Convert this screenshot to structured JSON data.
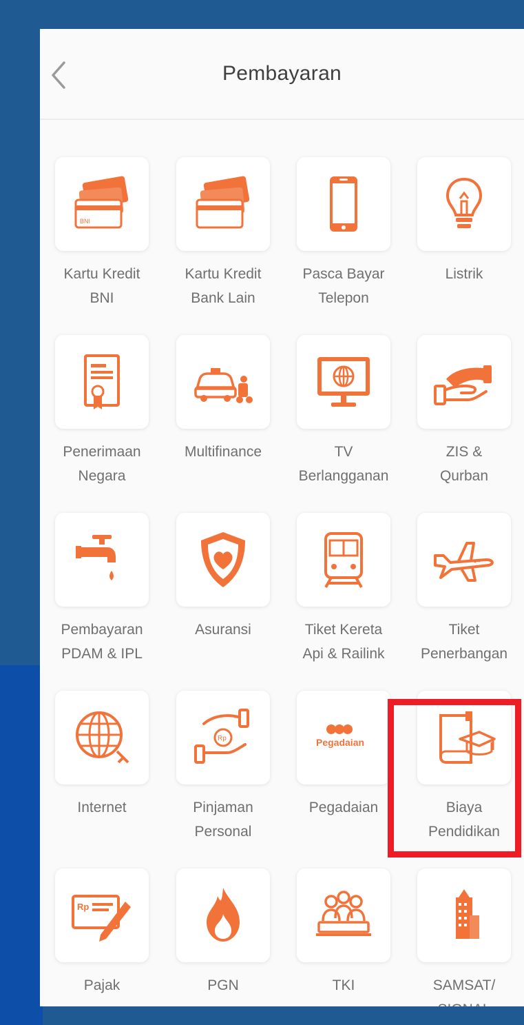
{
  "header": {
    "title": "Pembayaran",
    "back_icon": "chevron-left-icon"
  },
  "colors": {
    "accent": "#f2733a",
    "highlight": "#ee1c24",
    "frame": "#1f5a93"
  },
  "items": [
    {
      "label": "Kartu Kredit\nBNI",
      "icon": "credit-card-icon"
    },
    {
      "label": "Kartu Kredit\nBank Lain",
      "icon": "credit-card-icon"
    },
    {
      "label": "Pasca Bayar\nTelepon",
      "icon": "smartphone-icon"
    },
    {
      "label": "Listrik",
      "icon": "lightbulb-icon"
    },
    {
      "label": "Penerimaan\nNegara",
      "icon": "certificate-icon"
    },
    {
      "label": "Multifinance",
      "icon": "car-motorbike-icon"
    },
    {
      "label": "TV\nBerlangganan",
      "icon": "tv-icon"
    },
    {
      "label": "ZIS &\nQurban",
      "icon": "hand-giving-icon"
    },
    {
      "label": "Pembayaran\nPDAM & IPL",
      "icon": "faucet-icon"
    },
    {
      "label": "Asuransi",
      "icon": "shield-heart-icon"
    },
    {
      "label": "Tiket Kereta\nApi & Railink",
      "icon": "train-icon"
    },
    {
      "label": "Tiket\nPenerbangan",
      "icon": "airplane-icon"
    },
    {
      "label": "Internet",
      "icon": "globe-icon"
    },
    {
      "label": "Pinjaman\nPersonal",
      "icon": "hand-coin-icon"
    },
    {
      "label": "Pegadaian",
      "icon": "pegadaian-logo",
      "logo_text": "Pegadaian"
    },
    {
      "label": "Biaya\nPendidikan",
      "icon": "graduation-book-icon"
    },
    {
      "label": "Pajak",
      "icon": "tax-form-pen-icon",
      "icon_text": "Rp"
    },
    {
      "label": "PGN",
      "icon": "flame-icon"
    },
    {
      "label": "TKI",
      "icon": "workers-icon"
    },
    {
      "label": "SAMSAT/\nSIGNAL",
      "icon": "building-icon"
    }
  ]
}
